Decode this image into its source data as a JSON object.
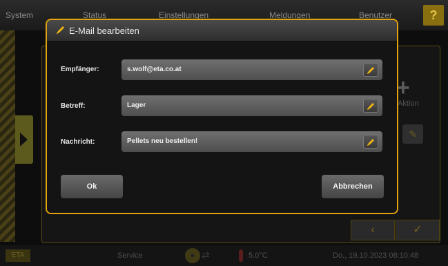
{
  "app": {
    "top_menu": [
      "System",
      "Status",
      "Einstellungen",
      "Meldungen",
      "Benutzer"
    ],
    "help_label": "?",
    "background_action_label": "Aktion",
    "nav_back_label": "‹",
    "nav_ok_label": "✓"
  },
  "statusbar": {
    "mode": "Service",
    "temperature": "5.0°C",
    "datetime": "Do., 19.10.2023 08:10:48"
  },
  "dialog": {
    "title": "E-Mail bearbeiten",
    "fields": [
      {
        "label": "Empfänger:",
        "value": "s.wolf@eta.co.at"
      },
      {
        "label": "Betreff:",
        "value": "Lager"
      },
      {
        "label": "Nachricht:",
        "value": "Pellets neu bestellen!"
      }
    ],
    "ok_label": "Ok",
    "cancel_label": "Abbrechen"
  },
  "colors": {
    "accent": "#e2a20e",
    "edit_icon": "#f2b80f"
  }
}
